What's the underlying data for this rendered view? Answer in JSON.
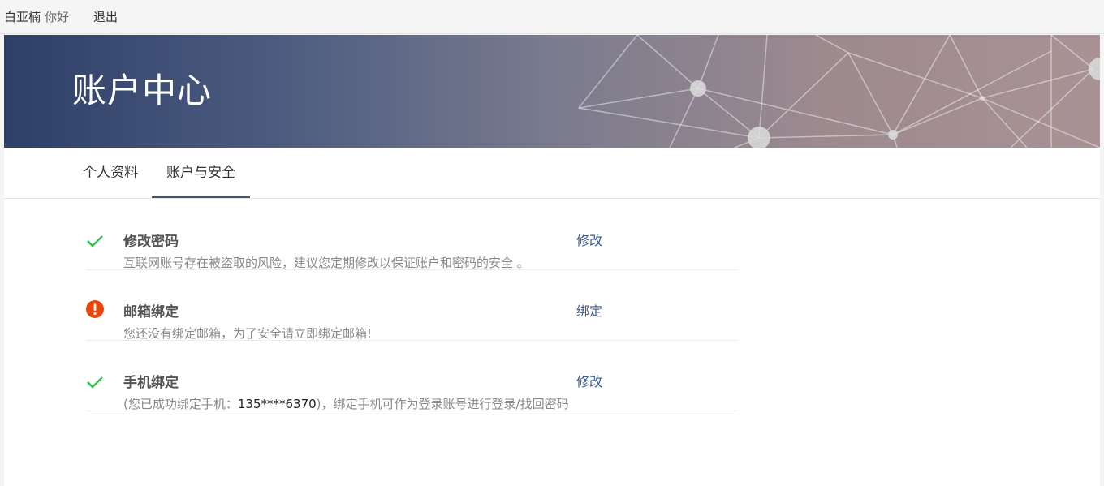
{
  "topbar": {
    "username": "白亚楠",
    "greeting": "你好",
    "logout_label": "退出"
  },
  "banner": {
    "title": "账户中心"
  },
  "tabs": [
    {
      "label": "个人资料",
      "active": false
    },
    {
      "label": "账户与安全",
      "active": true
    }
  ],
  "security_items": [
    {
      "status": "ok",
      "status_icon": "check-icon",
      "title": "修改密码",
      "description": "互联网账号存在被盗取的风险，建议您定期修改以保证账户和密码的安全 。",
      "action_label": "修改"
    },
    {
      "status": "warning",
      "status_icon": "warning-icon",
      "title": "邮箱绑定",
      "description": "您还没有绑定邮箱，为了安全请立即绑定邮箱!",
      "action_label": "绑定"
    },
    {
      "status": "ok",
      "status_icon": "check-icon",
      "title": "手机绑定",
      "description_prefix": "(您已成功绑定手机：",
      "phone": "135****6370",
      "description_suffix": ")，绑定手机可作为登录账号进行登录/找回密码",
      "action_label": "修改"
    }
  ],
  "colors": {
    "ok": "#2ec24a",
    "warning": "#e8460f",
    "link": "#3a5a8c",
    "tab_active_underline": "#3f5573"
  }
}
